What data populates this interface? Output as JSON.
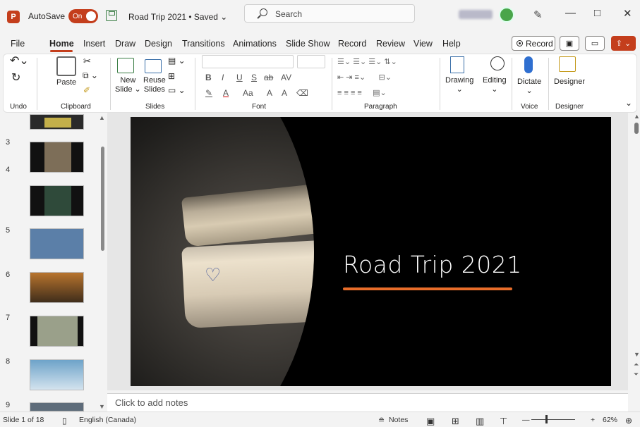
{
  "titlebar": {
    "app_badge": "P",
    "autosave_label": "AutoSave",
    "autosave_state": "On",
    "doc_title": "Road Trip 2021 • Saved ⌄",
    "search_placeholder": "Search"
  },
  "window_controls": {
    "minimize": "—",
    "maximize": "□",
    "close": "✕"
  },
  "tabs": [
    "File",
    "Home",
    "Insert",
    "Draw",
    "Design",
    "Transitions",
    "Animations",
    "Slide Show",
    "Record",
    "Review",
    "View",
    "Help"
  ],
  "active_tab": "Home",
  "record_button": "Record",
  "ribbon": {
    "undo_label": "Undo",
    "clipboard_label": "Clipboard",
    "paste_label": "Paste",
    "slides_group_label": "Slides",
    "new_slide_line1": "New",
    "new_slide_line2": "Slide ⌄",
    "reuse_line1": "Reuse",
    "reuse_line2": "Slides",
    "font_group_label": "Font",
    "paragraph_group_label": "Paragraph",
    "drawing_label": "Drawing",
    "editing_label": "Editing",
    "dictate_label": "Dictate",
    "voice_group_label": "Voice",
    "designer_label": "Designer",
    "designer_group_label": "Designer",
    "format_row1": [
      "B",
      "I",
      "U",
      "S",
      "ab",
      "AV"
    ],
    "format_row2": [
      "A",
      "Aa",
      "A",
      "A"
    ]
  },
  "thumbnails": [
    {
      "num": "3",
      "color": "#7d6e58"
    },
    {
      "num": "4",
      "color": "#2f4a3a"
    },
    {
      "num": "5",
      "color": "#5b7fa8"
    },
    {
      "num": "6",
      "color": "#b8742d"
    },
    {
      "num": "7",
      "color": "#9aa08a"
    },
    {
      "num": "8",
      "color": "#6ea3c9"
    },
    {
      "num": "9",
      "color": "#5e6c7a"
    }
  ],
  "slide": {
    "title": "Road Trip 2021",
    "accent_color": "#e86d2a"
  },
  "notes_placeholder": "Click to add notes",
  "status": {
    "slide_counter": "Slide 1 of 18",
    "language": "English (Canada)",
    "notes_button": "Notes",
    "zoom_percent": "62%"
  }
}
